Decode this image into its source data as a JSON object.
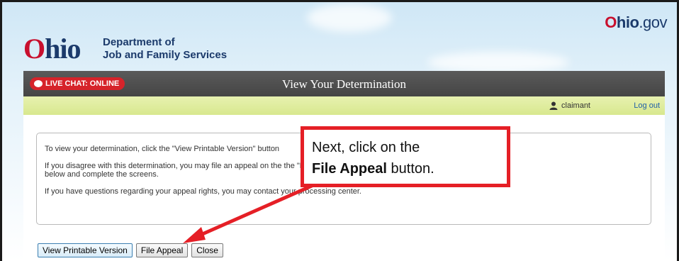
{
  "branding": {
    "ohio_gov": {
      "part1": "O",
      "part2": "hio",
      "part3": ".gov"
    },
    "logo": {
      "first": "O",
      "rest": "hio"
    },
    "department": {
      "line1": "Department of",
      "line2": "Job and Family Services"
    }
  },
  "titlebar": {
    "live_chat": {
      "label": "LIVE CHAT:",
      "status": "ONLINE"
    },
    "page_title": "View Your Determination"
  },
  "userbar": {
    "username": "claimant",
    "logout": "Log out"
  },
  "message": {
    "p1": "To view your determination, click the \"View Printable Version\" button",
    "p2": "If you disagree with this determination, you may file an appeal on the the \"File Appeal\" button below and complete the screens.",
    "p3": "If you have questions regarding your appeal rights, you may contact your processing center."
  },
  "buttons": {
    "view_printable": "View Printable Version",
    "file_appeal": "File Appeal",
    "close": "Close"
  },
  "callout": {
    "line1": "Next, click on the",
    "bold": "File Appeal",
    "tail": " button."
  },
  "colors": {
    "accent_red": "#e51f26",
    "ohio_red": "#c8102e",
    "ohio_blue": "#1b3a6b"
  }
}
